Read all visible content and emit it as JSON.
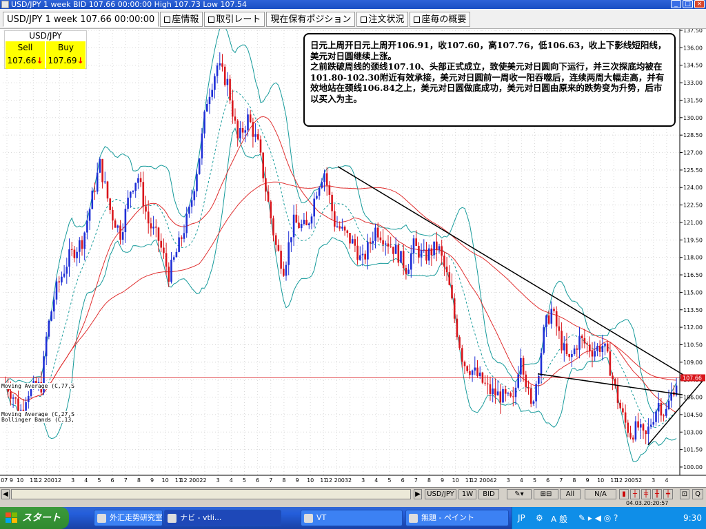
{
  "window": {
    "title": "USD/JPY 1 week BID 107.66 00:00:00 High 107.73 Low 107.54"
  },
  "tabs": [
    {
      "label": "USD/JPY 1 week 107.66 00:00:00",
      "checkbox": false
    },
    {
      "label": "座情報",
      "checkbox": true
    },
    {
      "label": "取引レート",
      "checkbox": true
    },
    {
      "label": "現在保有ポジション",
      "checkbox": false
    },
    {
      "label": "注文状況",
      "checkbox": true
    },
    {
      "label": "座毎の概要",
      "checkbox": true
    }
  ],
  "quote": {
    "pair": "USD/JPY",
    "sell_label": "Sell",
    "buy_label": "Buy",
    "sell_value": "107.66",
    "buy_value": "107.69",
    "arrow": "↓"
  },
  "annotation": {
    "text": "日元上周开日元上周开106.91，收107.60，高107.76，低106.63，收上下影线短阳线，美元对日圆继续上涨。\n之前跌破周线的颈线107.10、头部正式成立，致使美元对日圆向下运行，并三次探底均被在101.80-102.30附近有效承接，美元对日圆前一周收一阳吞噬后，连续两周大幅走高，并有效地站在颈线106.84之上，美元对日圆做底成功，美元对日圆由原来的跌势变为升势，后市以买入为主。"
  },
  "indicators": {
    "ma1": "Moving Average (C,77,S",
    "ma2": "Moving Average (C,27,S",
    "bb": "Bollinger Bands (C,13,"
  },
  "colors": {
    "bull": "#1f2fd6",
    "bear": "#d9161c",
    "ma_long": "#e03030",
    "ma_short": "#e03030",
    "bollinger": "#159a9a",
    "trendline": "#000000",
    "price_tag": "#d9161c"
  },
  "yaxis": {
    "min": 100.0,
    "max": 137.5,
    "ticks": [
      "137.50",
      "136.00",
      "134.50",
      "133.00",
      "131.50",
      "130.00",
      "128.50",
      "127.00",
      "125.50",
      "124.00",
      "122.50",
      "121.00",
      "119.50",
      "118.00",
      "116.50",
      "115.00",
      "113.50",
      "112.00",
      "110.50",
      "109.00",
      "107.50",
      "106.00",
      "104.50",
      "103.00",
      "101.50",
      "100.00"
    ],
    "last_price": "107.66"
  },
  "xaxis": {
    "labels": [
      "07 9",
      "10",
      "11",
      "12 2001",
      "2",
      "3",
      "4",
      "5",
      "6",
      "7",
      "8",
      "9",
      "10",
      "11",
      "12 2002",
      "2",
      "3",
      "4",
      "5",
      "6",
      "7",
      "8",
      "9",
      "10",
      "11",
      "12 2003",
      "2",
      "3",
      "4",
      "5",
      "6",
      "7",
      "8",
      "9",
      "10",
      "11",
      "12 2004",
      "2",
      "3",
      "4",
      "5",
      "6",
      "7",
      "8",
      "9",
      "10",
      "11",
      "12 2005",
      "2",
      "3",
      "4"
    ]
  },
  "controls": {
    "symbol": "USD/JPY",
    "timeframe": "1W",
    "side": "BID",
    "range": "All",
    "na": "N/A"
  },
  "statusline": {
    "time": "04.03.20:20:57"
  },
  "taskbar": {
    "start_label": "スタート",
    "items": [
      {
        "label": "外汇走势研究室"
      },
      {
        "label": "ナビ - vtli..."
      },
      {
        "label": "VT"
      },
      {
        "label": "無題 - ペイント"
      }
    ],
    "tray": {
      "lang": "JP",
      "ime": "A 般",
      "clock": "9:30"
    }
  },
  "chart_data": {
    "type": "candlestick",
    "title": "",
    "ylim": [
      100.0,
      137.5
    ],
    "candles_approx": [
      {
        "period": "2000-09",
        "open": 107.0,
        "close": 106.0,
        "high": 108.0,
        "low": 104.5
      },
      {
        "period": "2000-12",
        "open": 109.0,
        "close": 115.0,
        "high": 116.0,
        "low": 108.5
      },
      {
        "period": "2001-02",
        "open": 116.0,
        "close": 120.5,
        "high": 121.5,
        "low": 115.5
      },
      {
        "period": "2001-04",
        "open": 121.0,
        "close": 125.5,
        "high": 126.5,
        "low": 120.5
      },
      {
        "period": "2001-06",
        "open": 124.0,
        "close": 122.0,
        "high": 126.0,
        "low": 119.5
      },
      {
        "period": "2001-09",
        "open": 121.0,
        "close": 117.0,
        "high": 122.0,
        "low": 116.0
      },
      {
        "period": "2001-11",
        "open": 120.0,
        "close": 127.0,
        "high": 128.0,
        "low": 119.0
      },
      {
        "period": "2002-02",
        "open": 132.0,
        "close": 134.5,
        "high": 135.0,
        "low": 130.0
      },
      {
        "period": "2002-04",
        "open": 131.0,
        "close": 127.0,
        "high": 133.0,
        "low": 126.0
      },
      {
        "period": "2002-06",
        "open": 124.0,
        "close": 119.0,
        "high": 125.0,
        "low": 117.0
      },
      {
        "period": "2002-09",
        "open": 120.0,
        "close": 124.0,
        "high": 125.5,
        "low": 118.0
      },
      {
        "period": "2003-01",
        "open": 121.0,
        "close": 118.5,
        "high": 122.0,
        "low": 116.5
      },
      {
        "period": "2003-05",
        "open": 118.0,
        "close": 118.5,
        "high": 120.0,
        "low": 115.5
      },
      {
        "period": "2003-08",
        "open": 118.5,
        "close": 116.0,
        "high": 120.0,
        "low": 115.0
      },
      {
        "period": "2003-10",
        "open": 111.0,
        "close": 108.5,
        "high": 112.0,
        "low": 107.5
      },
      {
        "period": "2004-01",
        "open": 106.0,
        "close": 105.5,
        "high": 107.5,
        "low": 105.0
      },
      {
        "period": "2004-04",
        "open": 107.0,
        "close": 112.0,
        "high": 113.0,
        "low": 106.0
      },
      {
        "period": "2004-06",
        "open": 110.5,
        "close": 108.5,
        "high": 112.0,
        "low": 107.5
      },
      {
        "period": "2004-09",
        "open": 110.0,
        "close": 111.0,
        "high": 112.5,
        "low": 109.0
      },
      {
        "period": "2004-12",
        "open": 104.0,
        "close": 102.5,
        "high": 105.5,
        "low": 101.8
      },
      {
        "period": "2005-02",
        "open": 104.5,
        "close": 105.0,
        "high": 106.0,
        "low": 102.3
      },
      {
        "period": "2005-04",
        "open": 106.9,
        "close": 107.6,
        "high": 107.76,
        "low": 106.63
      }
    ]
  }
}
